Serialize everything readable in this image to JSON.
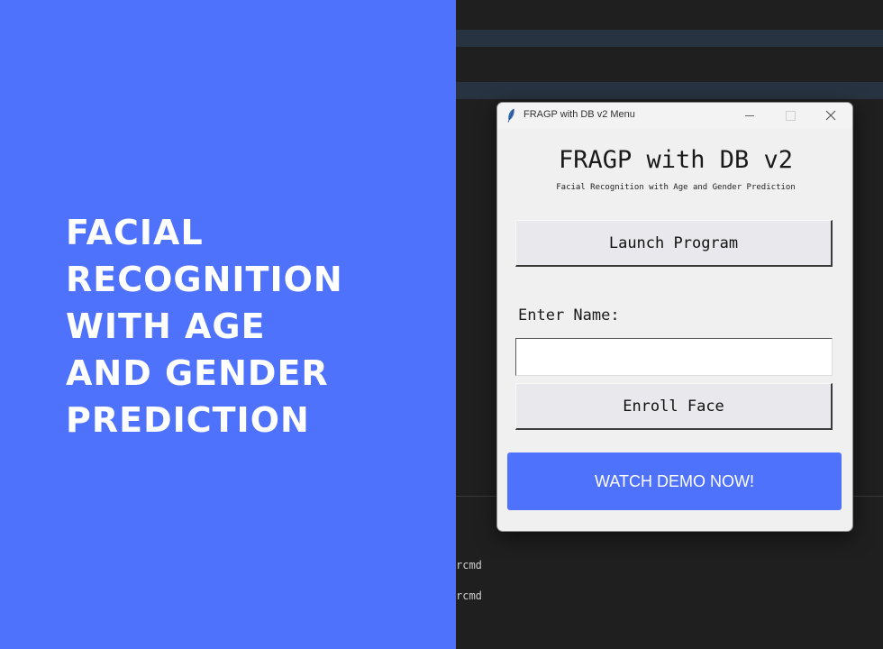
{
  "headline": {
    "lines": [
      "FACIAL",
      "RECOGNITION",
      "WITH AGE",
      "AND GENDER",
      "PREDICTION"
    ]
  },
  "terminal": {
    "line1": "rcmd",
    "line2": "rcmd"
  },
  "window": {
    "title": "FRAGP with DB v2 Menu",
    "app_title": "FRAGP with DB v2",
    "app_subtitle": "Facial Recognition with Age and Gender Prediction",
    "launch_label": "Launch Program",
    "name_label": "Enter Name:",
    "name_value": "",
    "enroll_label": "Enroll Face"
  },
  "cta": {
    "label": "WATCH DEMO NOW!"
  },
  "icons": {
    "app": "feather-icon",
    "minimize": "minimize-icon",
    "maximize": "maximize-icon",
    "close": "close-icon"
  },
  "colors": {
    "accent": "#4f72fc",
    "editor_bg": "#1f1f1f",
    "window_bg": "#f0f0f0"
  }
}
